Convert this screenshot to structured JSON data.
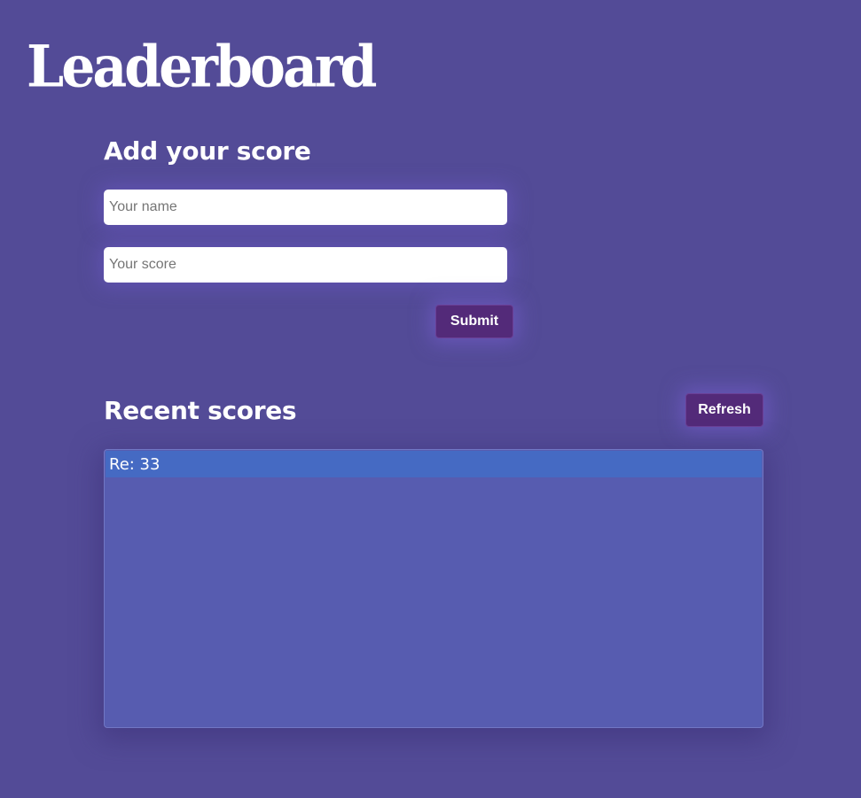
{
  "header": {
    "title": "Leaderboard"
  },
  "add_score": {
    "title": "Add your score",
    "name_placeholder": "Your name",
    "score_placeholder": "Your score",
    "submit_label": "Submit"
  },
  "recent": {
    "title": "Recent scores",
    "refresh_label": "Refresh",
    "items": [
      {
        "text": "Re: 33"
      }
    ]
  },
  "colors": {
    "background": "#534b97",
    "button": "#532a79",
    "list_background": "#575cb0",
    "list_row_highlight": "#456ac3"
  }
}
